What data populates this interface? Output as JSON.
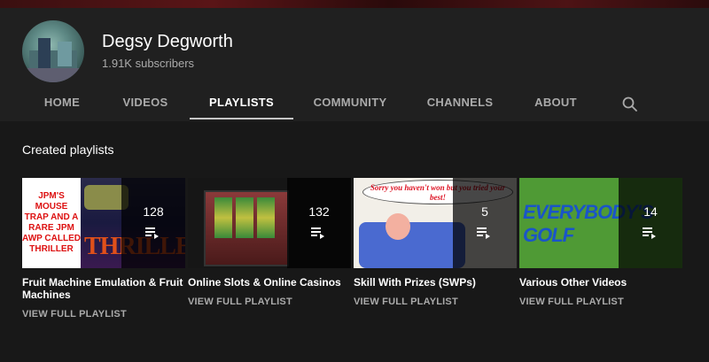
{
  "channel": {
    "name": "Degsy Degworth",
    "subscribers": "1.91K subscribers"
  },
  "tabs": [
    {
      "label": "HOME",
      "active": false
    },
    {
      "label": "VIDEOS",
      "active": false
    },
    {
      "label": "PLAYLISTS",
      "active": true
    },
    {
      "label": "COMMUNITY",
      "active": false
    },
    {
      "label": "CHANNELS",
      "active": false
    },
    {
      "label": "ABOUT",
      "active": false
    }
  ],
  "section": {
    "title": "Created playlists"
  },
  "playlists": [
    {
      "title": "Fruit Machine Emulation & Fruit Machines",
      "count": "128",
      "link": "VIEW FULL PLAYLIST",
      "thumb_text": "JPM'S MOUSE TRAP AND A RARE JPM AWP CALLED THRILLER",
      "thumb_logo": "THRILLER"
    },
    {
      "title": "Online Slots & Online Casinos",
      "count": "132",
      "link": "VIEW FULL PLAYLIST"
    },
    {
      "title": "Skill With Prizes (SWPs)",
      "count": "5",
      "link": "VIEW FULL PLAYLIST",
      "thumb_text": "Sorry you haven't won but you tried your best!"
    },
    {
      "title": "Various Other Videos",
      "count": "14",
      "link": "VIEW FULL PLAYLIST",
      "thumb_text": "EVERYBODY'S GOLF"
    }
  ],
  "colors": {
    "background": "#181818",
    "header": "#202020",
    "muted_text": "#aaaaaa"
  },
  "icons": {
    "search": "search-icon",
    "playlist": "playlist-icon"
  }
}
